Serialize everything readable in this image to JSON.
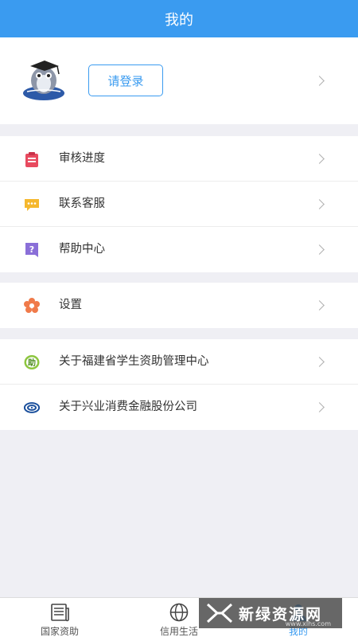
{
  "header": {
    "title": "我的"
  },
  "profile": {
    "login_label": "请登录"
  },
  "menu_group_1": [
    {
      "label": "审核进度",
      "icon": "clipboard-icon",
      "color": "#e84a5f"
    },
    {
      "label": "联系客服",
      "icon": "chat-icon",
      "color": "#f5b82e"
    },
    {
      "label": "帮助中心",
      "icon": "help-icon",
      "color": "#8a6fd8"
    }
  ],
  "menu_group_2": [
    {
      "label": "设置",
      "icon": "gear-icon",
      "color": "#f07a4a"
    }
  ],
  "menu_group_3": [
    {
      "label": "关于福建省学生资助管理中心",
      "icon": "zhu-logo-icon"
    },
    {
      "label": "关于兴业消费金融股份公司",
      "icon": "cib-logo-icon"
    }
  ],
  "tabbar": {
    "tabs": [
      {
        "label": "国家资助",
        "icon": "newspaper-icon"
      },
      {
        "label": "信用生活",
        "icon": "globe-icon"
      },
      {
        "label": "我的",
        "icon": "user-icon",
        "active": true
      }
    ]
  },
  "watermark": {
    "text": "新绿资源网",
    "url": "www.xlhs.com"
  },
  "colors": {
    "primary": "#3a9bf0",
    "background": "#efeff4"
  }
}
